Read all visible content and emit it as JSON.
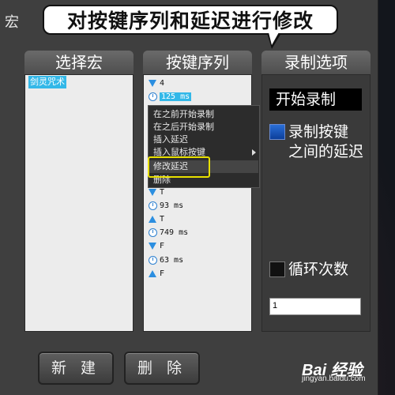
{
  "window": {
    "title": "宏"
  },
  "callout": {
    "text": "对按键序列和延迟进行修改"
  },
  "macros_panel": {
    "header": "选择宏",
    "items": [
      {
        "label": "剑灵咒术",
        "selected": true
      }
    ]
  },
  "keys_panel": {
    "header": "按键序列",
    "rows": [
      {
        "icon": "arrow-down-icon",
        "text": "4"
      },
      {
        "icon": "clock-icon",
        "text": "125 ms",
        "selected": true
      },
      {
        "icon": "arrow-up-icon",
        "text": ""
      },
      {
        "icon": "clock-icon",
        "text": ""
      },
      {
        "icon": "arrow-down-icon",
        "text": ""
      },
      {
        "icon": "clock-icon",
        "text": ""
      },
      {
        "icon": "arrow-up-icon",
        "text": ""
      },
      {
        "icon": "clock-icon",
        "text": ""
      },
      {
        "icon": "arrow-down-icon",
        "text": "T"
      },
      {
        "icon": "clock-icon",
        "text": "93 ms"
      },
      {
        "icon": "arrow-up-icon",
        "text": "T"
      },
      {
        "icon": "clock-icon",
        "text": "749 ms"
      },
      {
        "icon": "arrow-down-icon",
        "text": "F"
      },
      {
        "icon": "clock-icon",
        "text": "63 ms"
      },
      {
        "icon": "arrow-up-icon",
        "text": "F"
      }
    ]
  },
  "context_menu": {
    "items": [
      {
        "label": "在之前开始录制"
      },
      {
        "label": "在之后开始录制"
      },
      {
        "label": "插入延迟"
      },
      {
        "label": "插入鼠标按键",
        "has_submenu": true
      },
      {
        "label": "修改延迟",
        "highlighted": true
      },
      {
        "label": "删除"
      }
    ]
  },
  "options_panel": {
    "header": "录制选项",
    "start_button": "开始录制",
    "record_delay_line1": "录制按键",
    "record_delay_line2": "之间的延迟",
    "record_delay_checked": true,
    "loop_label": "循环次数",
    "loop_checked": false,
    "loop_count": "1"
  },
  "footer": {
    "new_button": "新 建",
    "delete_button": "删 除"
  },
  "watermark": {
    "brand": "Bai  经验",
    "sub": "jingyan.baidu.com"
  },
  "colors": {
    "selection": "#33b8e8",
    "highlight_box": "#e8e000",
    "panel_bg": "#ececec"
  }
}
